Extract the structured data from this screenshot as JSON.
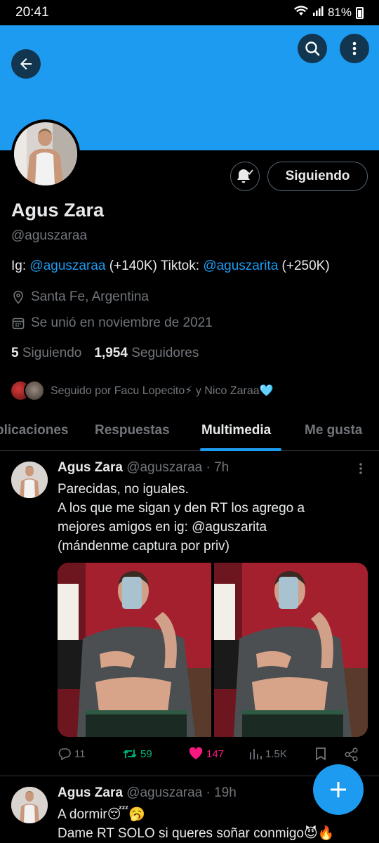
{
  "status_bar": {
    "time": "20:41",
    "battery": "81%"
  },
  "header": {
    "back_icon": "arrow-left-icon",
    "search_icon": "search-icon",
    "more_icon": "more-vertical-icon",
    "banner_color": "#1d9bf0"
  },
  "profile": {
    "name": "Agus Zara",
    "handle": "@aguszaraa",
    "follow_label": "Siguiendo",
    "bio_prefix": "Ig: ",
    "bio_ig": "@aguszaraa",
    "bio_mid": " (+140K) Tiktok: ",
    "bio_tt": "@aguszarita",
    "bio_suffix": " (+250K)",
    "location": "Santa Fe, Argentina",
    "joined": "Se unió en noviembre de 2021",
    "following_count": "5",
    "following_label": "Siguiendo",
    "followers_count": "1,954",
    "followers_label": "Seguidores",
    "followed_by": "Seguido por Facu Lopecito⚡ y Nico Zaraa🩵"
  },
  "tabs": [
    "plicaciones",
    "Respuestas",
    "Multimedia",
    "Me gusta"
  ],
  "active_tab": "Multimedia",
  "tweets": [
    {
      "name": "Agus Zara",
      "handle_time": "@aguszaraa · 7h",
      "lines": [
        "Parecidas, no iguales.",
        "A los que me sigan y den RT los agrego a",
        "mejores amigos en ig: @aguszarita",
        "(mándenme captura por priv)"
      ],
      "replies": "11",
      "retweets": "59",
      "likes": "147",
      "views": "1.5K"
    },
    {
      "name": "Agus Zara",
      "handle_time": "@aguszaraa · 19h",
      "lines": [
        "A dormir😴🥱",
        "Dame RT SOLO si queres soñar conmigo😈🔥"
      ]
    }
  ]
}
